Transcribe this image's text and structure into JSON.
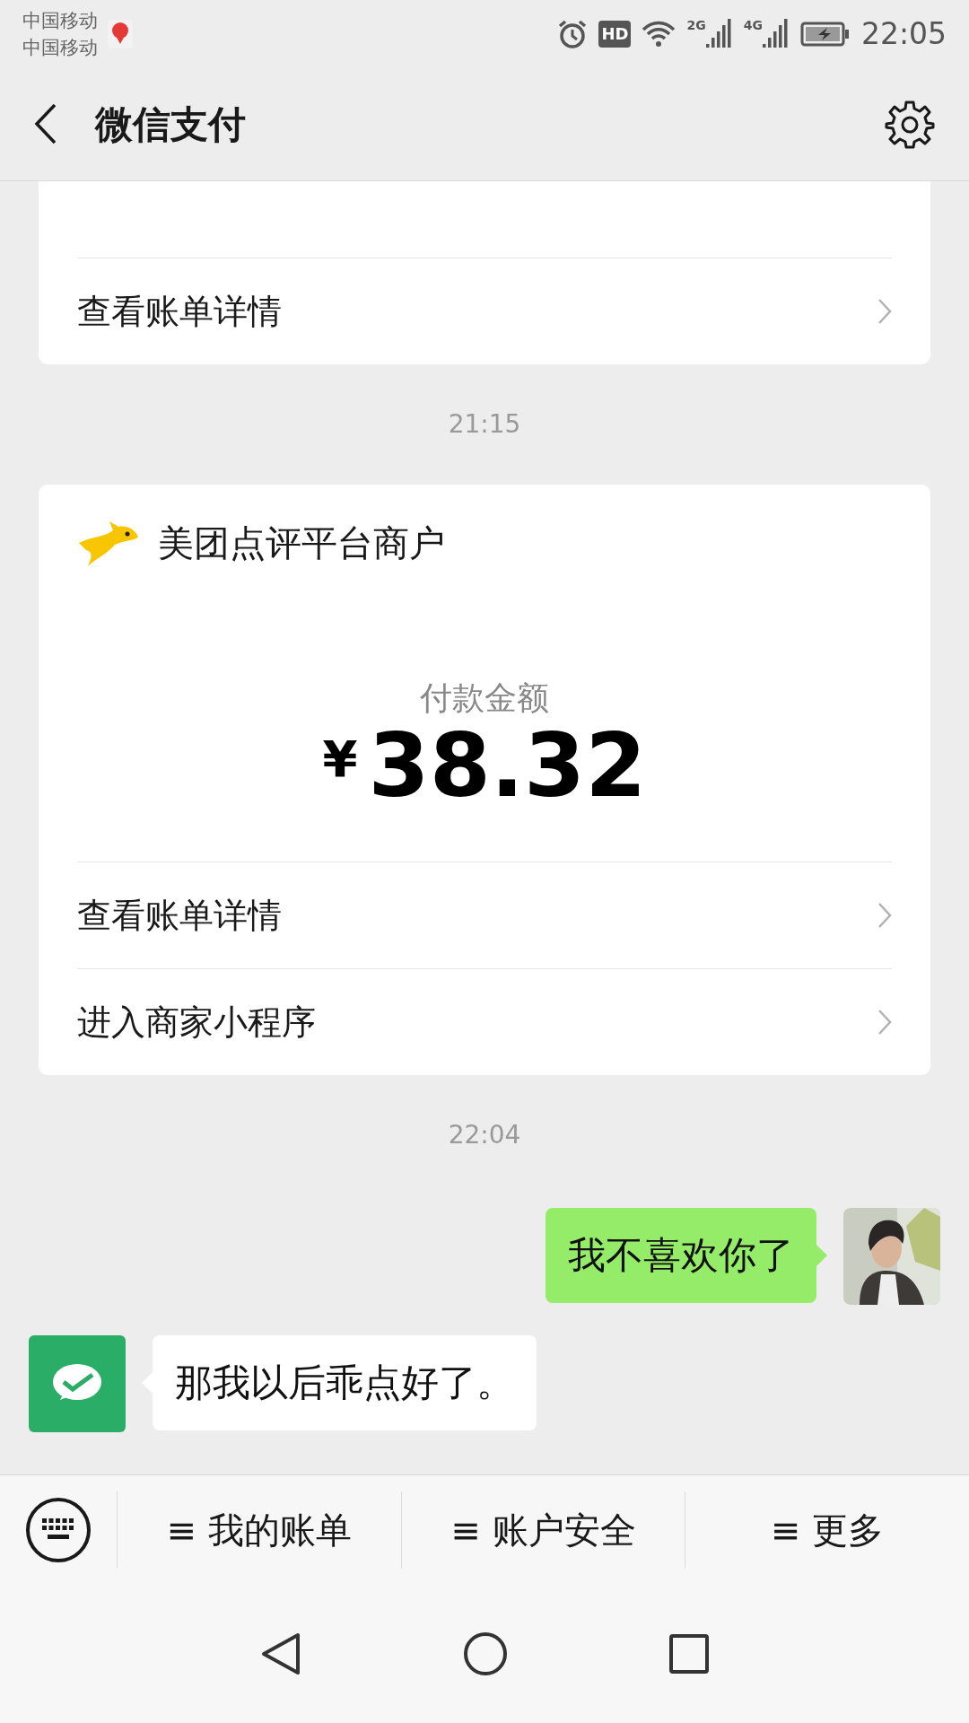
{
  "status_bar": {
    "carriers": [
      "中国移动",
      "中国移动"
    ],
    "hd_badge": "HD",
    "signals": [
      "2G",
      "4G"
    ],
    "time": "22:05"
  },
  "header": {
    "title": "微信支付"
  },
  "messages": [
    {
      "kind": "card_tail",
      "links": [
        "查看账单详情"
      ]
    },
    {
      "kind": "time",
      "text": "21:15"
    },
    {
      "kind": "payment",
      "merchant": "美团点评平台商户",
      "amount_label": "付款金额",
      "currency": "¥",
      "amount": "38.32",
      "links": [
        "查看账单详情",
        "进入商家小程序"
      ]
    },
    {
      "kind": "time",
      "text": "22:04"
    },
    {
      "kind": "sent",
      "text": "我不喜欢你了"
    },
    {
      "kind": "received",
      "text": "那我以后乖点好了。"
    }
  ],
  "menu": {
    "items": [
      "≡ 我的账单",
      "≡ 账户安全",
      "≡ 更多"
    ]
  }
}
